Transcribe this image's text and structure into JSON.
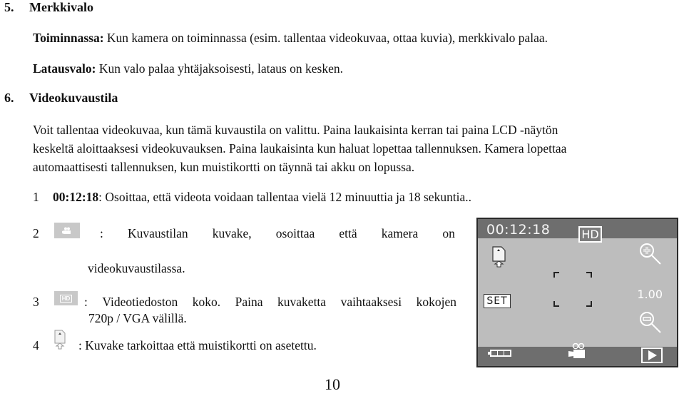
{
  "section5": {
    "number": "5.",
    "title": "Merkkivalo",
    "items": [
      {
        "label": "Toiminnassa:",
        "text": " Kun kamera on toiminnassa (esim. tallentaa videokuvaa, ottaa kuvia), merkkivalo palaa."
      },
      {
        "label": "Latausvalo:",
        "text": " Kun valo palaa yhtäjaksoisesti, lataus on kesken."
      }
    ]
  },
  "section6": {
    "number": "6.",
    "title": "Videokuvaustila",
    "paragraph_lines": [
      "Voit tallentaa videokuvaa, kun tämä kuvaustila on valittu. Paina laukaisinta kerran tai paina LCD -näytön",
      "keskeltä aloittaaksesi videokuvauksen. Paina laukaisinta kun haluat lopettaa tallennuksen. Kamera lopettaa",
      "automaattisesti tallennuksen, kun muistikortti on täynnä tai akku on lopussa."
    ],
    "list": [
      {
        "num": "1",
        "bold": "00:12:18",
        "text": ": Osoittaa, että videota voidaan tallentaa vielä 12 minuuttia ja 18 sekuntia.."
      },
      {
        "num": "2",
        "icon": "video-mode-icon",
        "words": [
          ":",
          "Kuvaustilan",
          "kuvake,",
          "osoittaa",
          "että",
          "kamera",
          "on"
        ],
        "line2": "videokuvaustilassa."
      },
      {
        "num": "3",
        "icon": "hd-icon",
        "icon_text": "HD",
        "words": [
          ":",
          "Videotiedoston",
          "koko.",
          "Paina",
          "kuvaketta",
          "vaihtaaksesi",
          "kokojen"
        ],
        "line2": "720p / VGA välillä."
      },
      {
        "num": "4",
        "icon": "memory-card-icon",
        "text": ": Kuvake tarkoittaa että muistikortti on asetettu."
      }
    ]
  },
  "camera_screen": {
    "time_remaining": "00:12:18",
    "resolution_badge": "HD",
    "set_button": "SET",
    "zoom_level": "1.00",
    "icons": [
      "memory-card-icon",
      "zoom-in-icon",
      "zoom-out-icon",
      "battery-icon",
      "video-camera-icon",
      "playback-icon"
    ],
    "battery_bars": 3
  },
  "page_number": "10"
}
